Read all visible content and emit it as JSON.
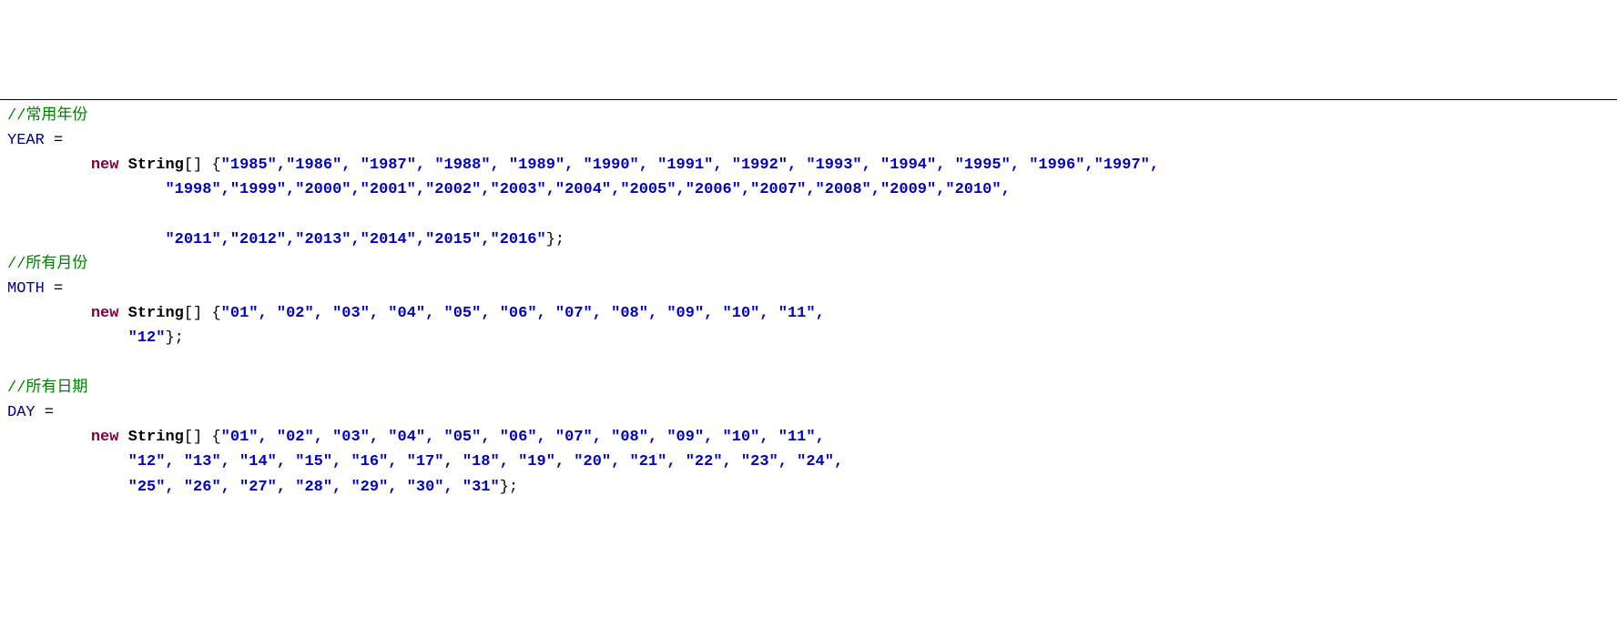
{
  "comment_year": "//常用年份",
  "var_year": "YEAR",
  "eq": " =",
  "kw_new": "new",
  "type_string": " String",
  "brackets_open": "[] {",
  "close_brace": "};",
  "year_line1_a": "\"1985\"",
  "year_line1_b": ",\"1986\", \"1987\", \"1988\", \"1989\", \"1990\", \"1991\", \"1992\", \"1993\", \"1994\", \"1995\", \"1996\",\"1997\",",
  "year_line2": "\"1998\",\"1999\",\"2000\",\"2001\",\"2002\",\"2003\",\"2004\",\"2005\",\"2006\",\"2007\",\"2008\",\"2009\",\"2010\",",
  "year_line3": "\"2011\",\"2012\",\"2013\",\"2014\",\"2015\",\"2016\"",
  "comment_month": "//所有月份",
  "var_month": "MOTH",
  "month_line1": "\"01\", \"02\", \"03\", \"04\", \"05\", \"06\", \"07\", \"08\", \"09\", \"10\", \"11\",",
  "month_line2": "\"12\"",
  "comment_day": "//所有日期",
  "var_day": "DAY",
  "day_line1": "\"01\", \"02\", \"03\", \"04\", \"05\", \"06\", \"07\", \"08\", \"09\", \"10\", \"11\",",
  "day_line2": "\"12\", \"13\", \"14\", \"15\", \"16\", \"17\", \"18\", \"19\", \"20\", \"21\", \"22\", \"23\", \"24\",",
  "day_line3": "\"25\", \"26\", \"27\", \"28\", \"29\", \"30\", \"31\""
}
